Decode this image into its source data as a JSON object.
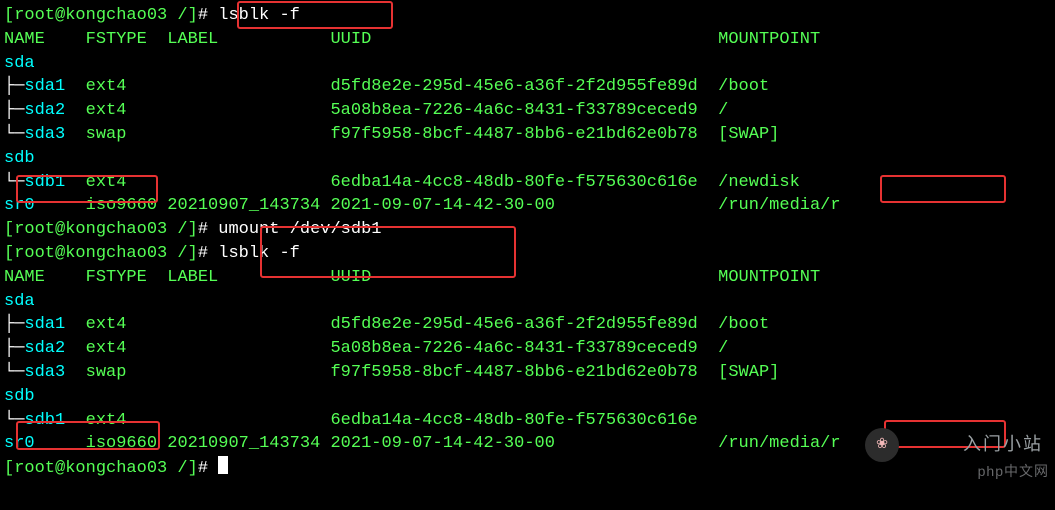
{
  "colors": {
    "green": "#55ff55",
    "cyan": "#00ffff",
    "white": "#ffffff",
    "red_box": "#e63232"
  },
  "prompt": {
    "host": "[root@kongchao03 /]",
    "char": "# "
  },
  "commands": {
    "c1": "lsblk -f",
    "c2": "umount /dev/sdb1",
    "c3": "lsblk -f"
  },
  "headers": {
    "name": "NAME",
    "fstype": "FSTYPE",
    "label": "LABEL",
    "uuid": "UUID",
    "mount": "MOUNTPOINT"
  },
  "blocks": [
    {
      "rows": [
        {
          "tree": "",
          "name": "sda",
          "fstype": "",
          "uuid": "",
          "mnt": ""
        },
        {
          "tree": "├─",
          "name": "sda1",
          "fstype": "ext4",
          "uuid": "d5fd8e2e-295d-45e6-a36f-2f2d955fe89d",
          "mnt": "/boot"
        },
        {
          "tree": "├─",
          "name": "sda2",
          "fstype": "ext4",
          "uuid": "5a08b8ea-7226-4a6c-8431-f33789ceced9",
          "mnt": "/"
        },
        {
          "tree": "└─",
          "name": "sda3",
          "fstype": "swap",
          "uuid": "f97f5958-8bcf-4487-8bb6-e21bd62e0b78",
          "mnt": "[SWAP]"
        },
        {
          "tree": "",
          "name": "sdb",
          "fstype": "",
          "uuid": "",
          "mnt": ""
        },
        {
          "tree": "└─",
          "name": "sdb1",
          "fstype": "ext4",
          "uuid": "6edba14a-4cc8-48db-80fe-f575630c616e",
          "mnt": "/newdisk"
        },
        {
          "tree": "",
          "name": "sr0",
          "fstype": "iso9660",
          "label": "20210907_143734",
          "uuid": "2021-09-07-14-42-30-00",
          "mnt": "/run/media/r"
        }
      ]
    },
    {
      "rows": [
        {
          "tree": "",
          "name": "sda",
          "fstype": "",
          "uuid": "",
          "mnt": ""
        },
        {
          "tree": "├─",
          "name": "sda1",
          "fstype": "ext4",
          "uuid": "d5fd8e2e-295d-45e6-a36f-2f2d955fe89d",
          "mnt": "/boot"
        },
        {
          "tree": "├─",
          "name": "sda2",
          "fstype": "ext4",
          "uuid": "5a08b8ea-7226-4a6c-8431-f33789ceced9",
          "mnt": "/"
        },
        {
          "tree": "└─",
          "name": "sda3",
          "fstype": "swap",
          "uuid": "f97f5958-8bcf-4487-8bb6-e21bd62e0b78",
          "mnt": "[SWAP]"
        },
        {
          "tree": "",
          "name": "sdb",
          "fstype": "",
          "uuid": "",
          "mnt": ""
        },
        {
          "tree": "└─",
          "name": "sdb1",
          "fstype": "ext4",
          "uuid": "6edba14a-4cc8-48db-80fe-f575630c616e",
          "mnt": ""
        },
        {
          "tree": "",
          "name": "sr0",
          "fstype": "iso9660",
          "label": "20210907_143734",
          "uuid": "2021-09-07-14-42-30-00",
          "mnt": "/run/media/r"
        }
      ]
    }
  ],
  "watermarks": {
    "site": "入门小站",
    "dev": "php中文网"
  }
}
